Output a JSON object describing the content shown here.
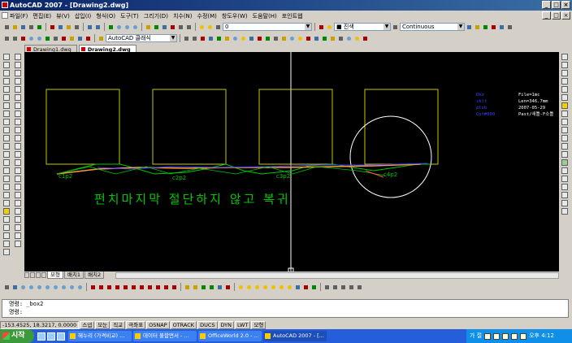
{
  "window": {
    "title": "AutoCAD 2007 - [Drawing2.dwg]"
  },
  "menu": [
    "파일(F)",
    "편집(E)",
    "뷰(V)",
    "삽입(I)",
    "형식(O)",
    "도구(T)",
    "그리기(D)",
    "치수(N)",
    "수정(M)",
    "창도우(W)",
    "도움말(H)",
    "포인트웹"
  ],
  "layer_combo": "0",
  "color_combo": "■ 진색",
  "linetype_combo": "Continuous",
  "style_combo": "AutoCAD 클래식",
  "file_tabs": [
    "Drawing1.dwg",
    "Drawing2.dwg"
  ],
  "canvas": {
    "big_text": "펀치마지막 절단하지 않고 복귀",
    "labels": [
      "c1p2",
      "c2p2",
      "c3p2",
      "c4p2"
    ],
    "info_left": [
      "Dkz",
      "sklt",
      "plsb",
      "Cut#000"
    ],
    "info_right": [
      "File=1mc",
      "Len=346.7mm",
      "2007-05-29",
      "Past/새틀-F소틀"
    ]
  },
  "layout_tabs": [
    "모형",
    "배치1",
    "배치2"
  ],
  "command": {
    "line1": "명령: _box2",
    "line2": "명령:"
  },
  "status": {
    "coords": "-153.4525, 18.3217, 0.0000",
    "buttons": [
      "스냅",
      "모눈",
      "직교",
      "극좌표",
      "OSNAP",
      "OTRACK",
      "DUCS",
      "DYN",
      "LWT",
      "모형"
    ]
  },
  "taskbar": {
    "start": "시작",
    "tasks": [
      "헤누리 (가격비교) ...",
      "데이터 불합면서 - ...",
      "OfficeWorld 2.0 - ...",
      "AutoCAD 2007 - [..."
    ],
    "lang": "가 절",
    "clock": "오후 4:12"
  },
  "colors": {
    "canvas": "#000000",
    "rect": "#c8c800",
    "circle": "#ffffff",
    "path_green": "#00c800",
    "path_orange": "#ff9a3c",
    "path_blue": "#3c3cff",
    "label": "#00c800",
    "info": "#4040ff"
  }
}
